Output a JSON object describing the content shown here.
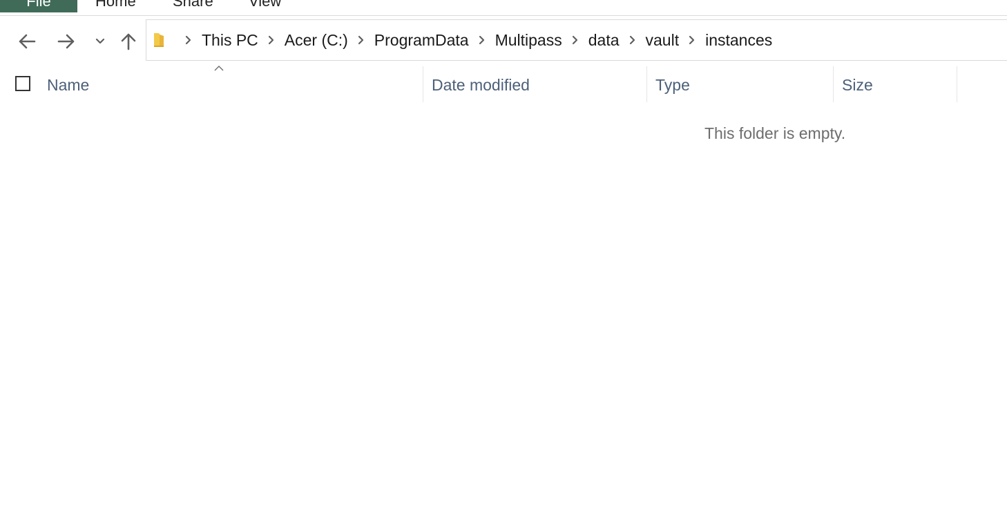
{
  "ribbon": {
    "tabs": [
      {
        "label": "File"
      },
      {
        "label": "Home"
      },
      {
        "label": "Share"
      },
      {
        "label": "View"
      }
    ],
    "file_tab_color": "#3f6b58"
  },
  "navigation": {
    "back_icon": "arrow-left-icon",
    "forward_icon": "arrow-right-icon",
    "recent_icon": "chevron-down-icon",
    "up_icon": "arrow-up-icon"
  },
  "address": {
    "icon": "folder-icon",
    "crumbs": [
      "This PC",
      "Acer (C:)",
      "ProgramData",
      "Multipass",
      "data",
      "vault",
      "instances"
    ]
  },
  "columns": {
    "name": "Name",
    "date_modified": "Date modified",
    "type": "Type",
    "size": "Size",
    "sort_indicator": "^"
  },
  "content": {
    "empty_message": "This folder is empty."
  },
  "colors": {
    "header_text": "#4c607a",
    "empty_text": "#6d6d6d"
  }
}
